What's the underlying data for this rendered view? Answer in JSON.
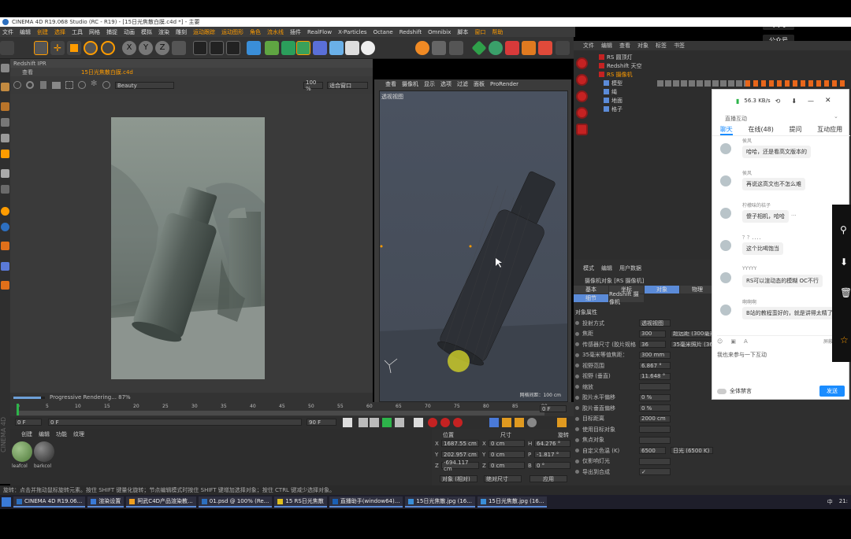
{
  "window": {
    "title": "CINEMA 4D R19.068 Studio (RC - R19) - [15日光焦散白膜.c4d *] - 主要"
  },
  "overlay": {
    "qq_label": "QQ号",
    "gzh_label": "公众号"
  },
  "menubar": {
    "items": [
      "文件",
      "编辑",
      "创建",
      "选择",
      "工具",
      "网格",
      "捕捉",
      "动画",
      "模拟",
      "渲染",
      "雕刻",
      "运动跟踪",
      "运动图形",
      "角色",
      "流水线",
      "插件",
      "RealFlow",
      "X-Particles",
      "Octane",
      "Redshift",
      "Omnibix",
      "脚本",
      "窗口",
      "帮助"
    ],
    "highlight_indices": [
      2,
      3,
      11,
      12,
      13,
      14,
      22,
      23
    ]
  },
  "toolbar": {
    "axes": [
      "X",
      "Y",
      "Z"
    ]
  },
  "ipr": {
    "title": "Redshift IPR",
    "tab_view": "查看",
    "file_tab": "15日光焦散白膜.c4d",
    "beauty_label": "Beauty",
    "zoom_label": "100 %",
    "fit_label": "适合窗口",
    "progress_text": "Progressive Rendering... 87%",
    "progress": 0.87
  },
  "viewport": {
    "menu": [
      "查看",
      "摄像机",
      "显示",
      "选项",
      "过滤",
      "面板",
      "ProRender"
    ],
    "label": "透视视图",
    "grid_label": "网格间距：100 cm"
  },
  "timeline": {
    "ticks": [
      "0",
      "5",
      "10",
      "15",
      "20",
      "25",
      "30",
      "35",
      "40",
      "45",
      "50",
      "55",
      "60",
      "65",
      "70",
      "75",
      "80",
      "85",
      "90"
    ],
    "frame_label": "0 F",
    "start_frame": "0 F",
    "current_field": "0 F",
    "end_field": "90 F",
    "end_frame": "90 F"
  },
  "materials": {
    "menu": [
      "创建",
      "编辑",
      "功能",
      "纹理"
    ],
    "items": [
      "leafcol",
      "barkcol"
    ]
  },
  "coords": {
    "headers": [
      "位置",
      "尺寸",
      "旋转"
    ],
    "rows": [
      {
        "axis": "X",
        "pos": "1687.55 cm",
        "size_axis": "X",
        "size": "0 cm",
        "rot_axis": "H",
        "rot": "64.276 °"
      },
      {
        "axis": "Y",
        "pos": "202.957 cm",
        "size_axis": "Y",
        "size": "0 cm",
        "rot_axis": "P",
        "rot": "-1.817 °"
      },
      {
        "axis": "Z",
        "pos": "-694.117 cm",
        "size_axis": "Z",
        "size": "0 cm",
        "rot_axis": "B",
        "rot": "0 °"
      }
    ],
    "mode_label": "对象 (相对)",
    "size_mode_label": "绝对尺寸",
    "apply_label": "应用"
  },
  "objects": {
    "menu": [
      "文件",
      "编辑",
      "查看",
      "对象",
      "标签",
      "书签"
    ],
    "items": [
      {
        "name": "RS 圆顶灯",
        "highlight": false
      },
      {
        "name": "Redshift 天空",
        "highlight": false
      },
      {
        "name": "RS 摄像机",
        "highlight": true
      },
      {
        "name": "模型",
        "highlight": false
      },
      {
        "name": "绳",
        "highlight": false
      },
      {
        "name": "地面",
        "highlight": false
      },
      {
        "name": "格子",
        "highlight": false
      }
    ]
  },
  "attributes": {
    "menu": [
      "模式",
      "编辑",
      "用户数据"
    ],
    "object_label": "摄像机对象 [RS 摄像机]",
    "tabs": [
      "基本",
      "坐标",
      "对象",
      "物理"
    ],
    "subtabs": [
      "细节",
      "Redshift 摄像机"
    ],
    "section": "对象属性",
    "rows": [
      {
        "label": "投射方式",
        "value": "透视视图"
      },
      {
        "label": "焦距",
        "value": "300",
        "extra": "超远距 (300毫米)"
      },
      {
        "label": "传感器尺寸 (胶片规格)",
        "value": "36",
        "extra": "35毫米照片 (36.0毫米)"
      },
      {
        "label": "35毫米等值焦距：",
        "value": "300 mm"
      },
      {
        "label": "视野范围",
        "value": "6.867 °"
      },
      {
        "label": "视野 (垂直)",
        "value": "11.648 °"
      },
      {
        "label": "缩放",
        "value": ""
      },
      {
        "label": "胶片水平偏移",
        "value": "0 %"
      },
      {
        "label": "胶片垂直偏移",
        "value": "0 %"
      },
      {
        "label": "目标距离",
        "value": "2000 cm"
      },
      {
        "label": "使用目标对象",
        "value": ""
      },
      {
        "label": "焦点对象",
        "value": ""
      },
      {
        "label": "自定义色温 (K)",
        "value": "6500",
        "extra": "日光 (6500 K)"
      },
      {
        "label": "仅影响灯光",
        "value": ""
      },
      {
        "label": "导出到合成",
        "value": "✓"
      }
    ]
  },
  "chat": {
    "speed": "56.3 KB/s",
    "title": "直播互动",
    "tabs": [
      "聊天",
      "在线(48)",
      "提问",
      "互动应用"
    ],
    "messages": [
      {
        "name": "侯风",
        "text": "哈哈，还是看高文版本的"
      },
      {
        "name": "侯风",
        "text": "再说这高文也不怎么难"
      },
      {
        "name": "柠檬味的桔子",
        "text": "傻子相机，哈哈"
      },
      {
        "name": "？？．．．．",
        "text": "这个比喝饱当"
      },
      {
        "name": "YYYYY",
        "text": "RS可以渲动态的模糊 OC不行"
      },
      {
        "name": "啊啊啊",
        "text": "B站的教程蛮好的，就是讲得太精了"
      }
    ],
    "more_label": "...",
    "input_placeholder": "我也来参与一下互动",
    "mute_label": "全体禁言",
    "send_label": "发送",
    "screenshot_label": "屏蔽设置等"
  },
  "status": {
    "text": "旋转：点击并拖动鼠标旋转元素。按住 SHIFT 键量化旋转；节点编辑模式时按住 SHIFT 键增加选择对象；按住 CTRL 键减少选择对象。"
  },
  "taskbar": {
    "items": [
      "CINEMA 4D R19.06...",
      "渲染设置",
      "阿武C4D产品渲染教...",
      "01.psd @ 100% (Re...",
      "15 RS日光焦散",
      "直播助手(window64)...",
      "15日光焦散.jpg (16...",
      "15日光焦散.jpg (16..."
    ],
    "tray": [
      "中",
      "21:"
    ]
  },
  "colors": {
    "accent_orange": "#ff9c00",
    "c4d_red": "#c52222",
    "chat_blue": "#1a8cff",
    "selected_blue": "#5b8bd8"
  }
}
